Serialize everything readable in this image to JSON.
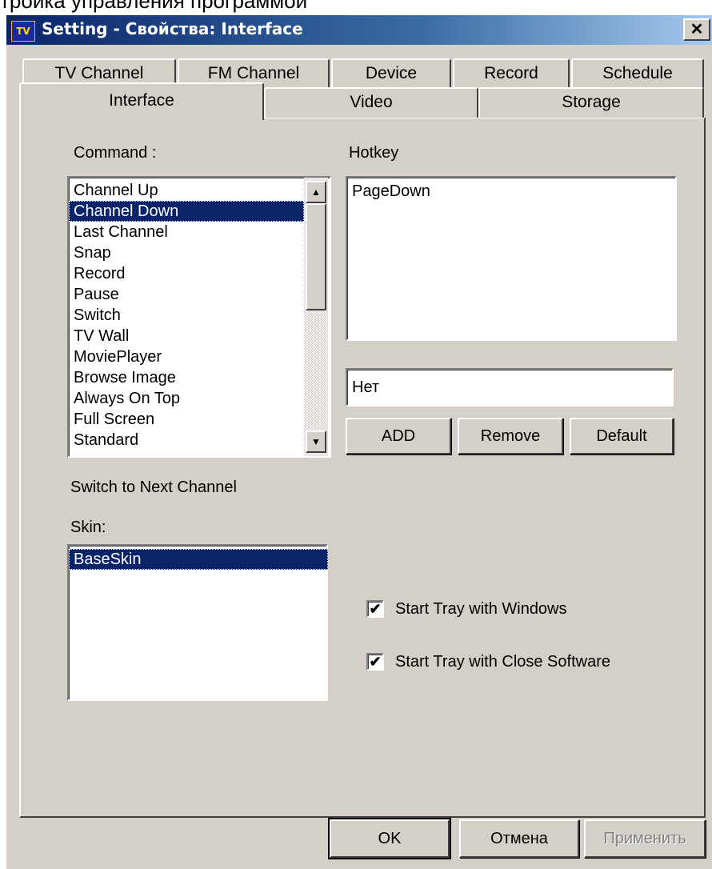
{
  "page_caption": "тройка управления программой",
  "window": {
    "title": "Setting - Свойства: Interface",
    "icon": "TV",
    "close_label": "✕"
  },
  "tabs_row1": [
    {
      "label": "TV Channel"
    },
    {
      "label": "FM Channel"
    },
    {
      "label": "Device"
    },
    {
      "label": "Record"
    },
    {
      "label": "Schedule"
    }
  ],
  "tabs_row2": [
    {
      "label": "Interface",
      "active": true
    },
    {
      "label": "Video"
    },
    {
      "label": "Storage"
    }
  ],
  "command": {
    "label": "Command :",
    "items": [
      "Channel Up",
      "Channel Down",
      "Last Channel",
      "Snap",
      "Record",
      "Pause",
      "Switch",
      "TV Wall",
      "MoviePlayer",
      "Browse Image",
      "Always On Top",
      "Full Screen",
      "Standard"
    ],
    "selected_index": 1,
    "scroll_up": "▲",
    "scroll_down": "▼"
  },
  "hotkey": {
    "label": "Hotkey",
    "items": [
      "PageDown"
    ],
    "input_value": "Нет",
    "add_label": "ADD",
    "remove_label": "Remove",
    "default_label": "Default"
  },
  "description": "Switch to Next Channel",
  "skin": {
    "label": "Skin:",
    "items": [
      "BaseSkin"
    ],
    "selected_index": 0
  },
  "options": [
    {
      "label": "Start Tray with Windows",
      "checked": true
    },
    {
      "label": "Start Tray with Close Software",
      "checked": true
    }
  ],
  "footer": {
    "ok_label": "OK",
    "cancel_label": "Отмена",
    "apply_label": "Применить"
  },
  "colors": {
    "face": "#d4d0c8",
    "selection": "#0a246a",
    "title_start": "#0a246a",
    "title_end": "#a6caf0"
  },
  "icons": {
    "app": "tv-app-icon",
    "close": "close-icon",
    "scroll_up": "arrow-up-icon",
    "scroll_down": "arrow-down-icon",
    "check": "checkmark-icon"
  }
}
